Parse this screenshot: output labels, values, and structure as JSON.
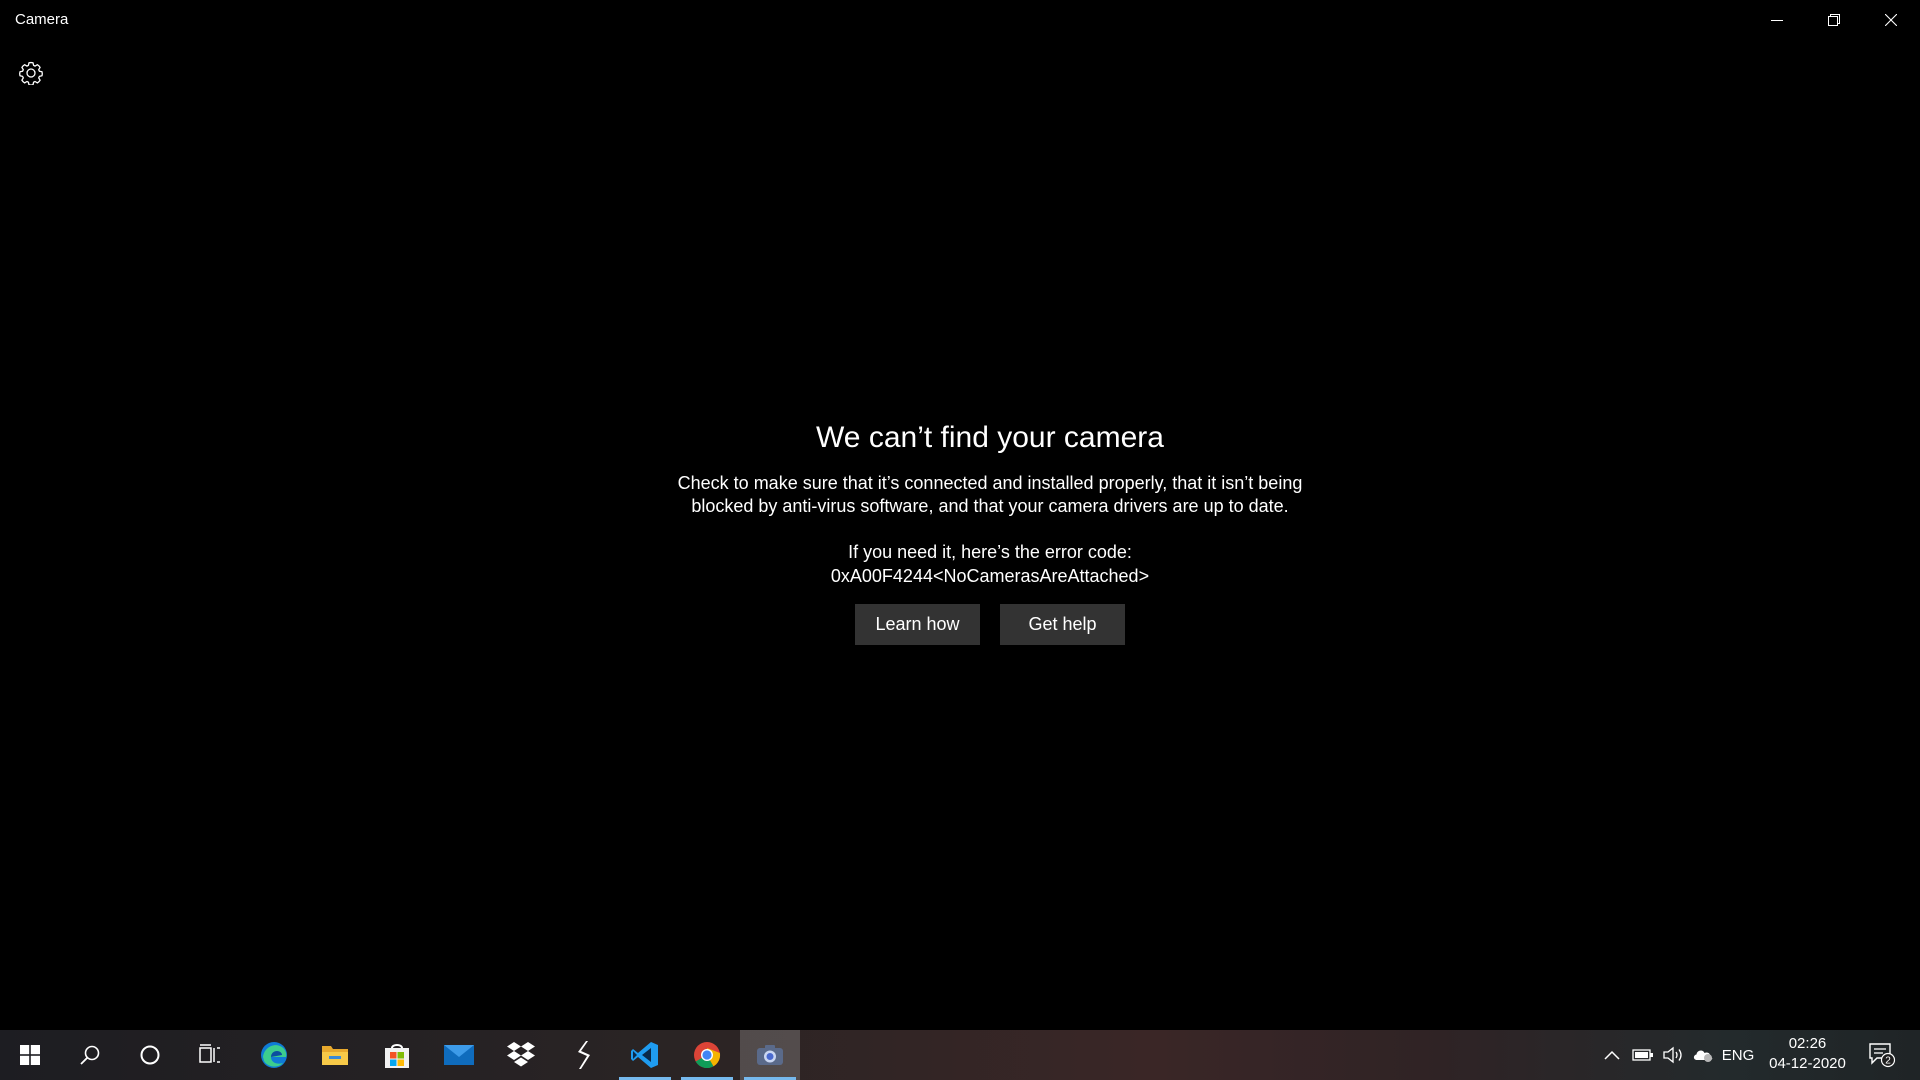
{
  "window": {
    "title": "Camera"
  },
  "message": {
    "title": "We can’t find your camera",
    "body_line1": "Check to make sure that it’s connected and installed properly, that it isn’t being",
    "body_line2": "blocked by anti-virus software, and that your camera drivers are up to date.",
    "error_intro": "If you need it, here’s the error code:",
    "error_code": "0xA00F4244<NoCamerasAreAttached>",
    "learn_how_label": "Learn how",
    "get_help_label": "Get help"
  },
  "taskbar": {
    "items": [
      {
        "icon": "windows-start-icon"
      },
      {
        "icon": "search-icon"
      },
      {
        "icon": "cortana-icon"
      },
      {
        "icon": "task-view-icon"
      },
      {
        "icon": "edge-icon"
      },
      {
        "icon": "file-explorer-icon"
      },
      {
        "icon": "microsoft-store-icon"
      },
      {
        "icon": "mail-icon"
      },
      {
        "icon": "dropbox-icon"
      },
      {
        "icon": "app-s-icon"
      },
      {
        "icon": "vscode-icon"
      },
      {
        "icon": "chrome-icon"
      },
      {
        "icon": "camera-app-icon"
      }
    ],
    "tray": {
      "language": "ENG",
      "time": "02:26",
      "date": "04-12-2020",
      "notification_count": "2"
    }
  },
  "colors": {
    "background": "#000000",
    "button_bg": "#333333",
    "accent": "#76b9ed"
  }
}
